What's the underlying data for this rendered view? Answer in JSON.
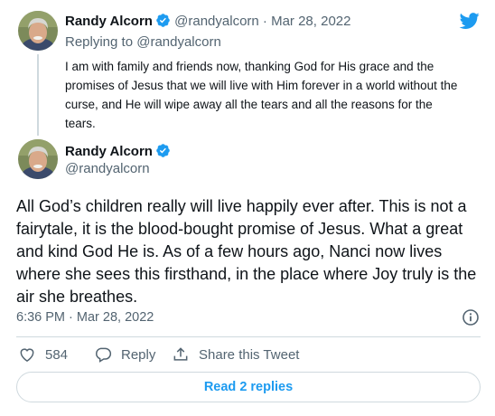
{
  "colors": {
    "accent": "#1d9bf0",
    "text": "#0f1419",
    "muted": "#536471",
    "border": "#cfd9de"
  },
  "reply_tweet": {
    "author_name": "Randy Alcorn",
    "handle": "@randyalcorn",
    "separator": "·",
    "date": "Mar 28, 2022",
    "replying_prefix": "Replying to",
    "replying_handle": "@randyalcorn",
    "text": "I am with family and friends now, thanking God for His grace and the promises of Jesus that we will live with Him forever in a world without the curse, and He will wipe away all the tears and all the reasons for the tears."
  },
  "main_tweet": {
    "author_name": "Randy Alcorn",
    "handle": "@randyalcorn",
    "text": "All God’s children really will live happily ever after. This is not a fairytale, it is the blood-bought promise of Jesus. What a great and kind God He is. As of a few hours ago, Nanci now lives where she sees this firsthand, in the place where Joy truly is the air she breathes.",
    "timestamp": "6:36 PM · Mar 28, 2022"
  },
  "actions": {
    "like_count": "584",
    "reply_label": "Reply",
    "share_label": "Share this Tweet"
  },
  "read_replies_label": "Read 2 replies",
  "icons": {
    "brand": "twitter-bird-icon",
    "verified": "verified-badge-icon",
    "info": "info-icon",
    "like": "heart-icon",
    "reply": "speech-bubble-icon",
    "share": "share-arrow-icon"
  }
}
